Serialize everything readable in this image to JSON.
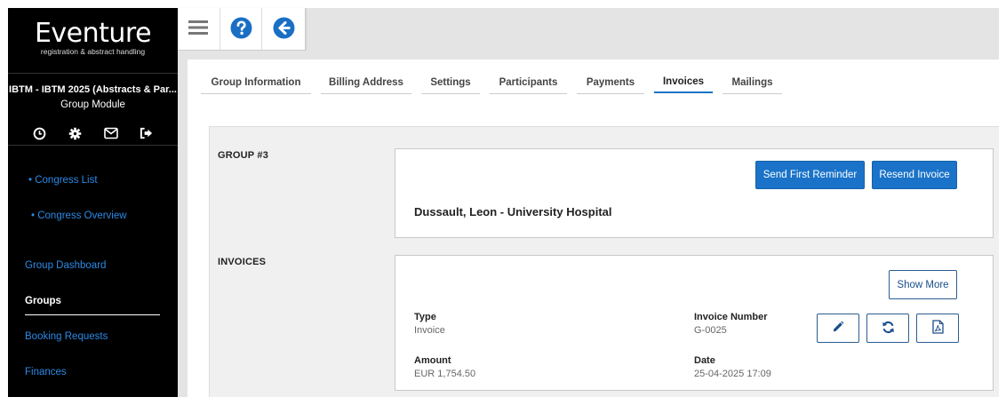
{
  "sidebar": {
    "logo_title": "Eventure",
    "logo_subtitle": "registration & abstract handling",
    "congress_name": "IBTM - IBTM 2025 (Abstracts & Par...",
    "module_name": "Group Module",
    "icons": [
      "clock-icon",
      "gear-icon",
      "mail-icon",
      "logout-icon"
    ],
    "links": {
      "congress_list": "• Congress List",
      "congress_overview": "• Congress Overview",
      "group_dashboard": "Group Dashboard",
      "groups": "Groups",
      "booking_requests": "Booking Requests",
      "finances": "Finances"
    }
  },
  "toolbar": {
    "icons": [
      "hamburger-icon",
      "help-icon",
      "back-icon"
    ]
  },
  "tabs": [
    {
      "label": "Group Information",
      "active": false
    },
    {
      "label": "Billing Address",
      "active": false
    },
    {
      "label": "Settings",
      "active": false
    },
    {
      "label": "Participants",
      "active": false
    },
    {
      "label": "Payments",
      "active": false
    },
    {
      "label": "Invoices",
      "active": true
    },
    {
      "label": "Mailings",
      "active": false
    }
  ],
  "group": {
    "section_label": "GROUP #3",
    "send_reminder_label": "Send First Reminder",
    "resend_invoice_label": "Resend Invoice",
    "contact": "Dussault, Leon - University Hospital"
  },
  "invoices": {
    "section_label": "INVOICES",
    "show_more_label": "Show More",
    "type_label": "Type",
    "type_value": "Invoice",
    "number_label": "Invoice Number",
    "number_value": "G-0025",
    "amount_label": "Amount",
    "amount_value": "EUR 1,754.50",
    "date_label": "Date",
    "date_value": "25-04-2025 17:09",
    "action_icons": [
      "pencil-icon",
      "refresh-icon",
      "pdf-icon"
    ]
  },
  "colors": {
    "accent": "#1a73c8",
    "link": "#2b8ae6",
    "sidebar_bg": "#000000"
  }
}
